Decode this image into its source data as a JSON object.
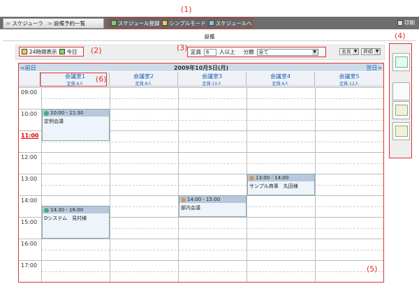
{
  "annotations": {
    "a1": "(1)",
    "a2": "(2)",
    "a3": "(3)",
    "a4": "(4)",
    "a5": "(5)",
    "a6": "(6)"
  },
  "nav": {
    "schedule": "スケジューラ",
    "reservations": "設備予約一覧"
  },
  "toolbar": {
    "register": "スケジュール登録",
    "simple": "シンプルモード",
    "goto": "スケジュールへ",
    "print": "印刷"
  },
  "section_title": "設備",
  "options": {
    "all_day": "24時間表示",
    "today": "今日",
    "capacity_label": "定員",
    "capacity_value": "6",
    "capacity_suffix": "人以上",
    "category_label": "分類",
    "category_value": "全て",
    "sort1": "名前",
    "sort2": "昇順"
  },
  "calendar": {
    "prev": "<前日",
    "next": "翌日>",
    "date": "2009年10月5日(月)",
    "rooms": [
      {
        "name": "会議室1",
        "cap": "定員:6人"
      },
      {
        "name": "会議室2",
        "cap": "定員:8人"
      },
      {
        "name": "会議室3",
        "cap": "定員:10人"
      },
      {
        "name": "会議室4",
        "cap": "定員:6人"
      },
      {
        "name": "会議室5",
        "cap": "定員:12人"
      }
    ],
    "hours": [
      "09:00",
      "10:00",
      "11:00",
      "12:00",
      "13:00",
      "14:00",
      "15:00",
      "16:00",
      "17:00"
    ],
    "current_hour": "11:00",
    "events": [
      {
        "time": "10:00 - 11:30",
        "title": "定例会議"
      },
      {
        "time": "14:30 - 16:00",
        "title": "Dシステム　見村様"
      },
      {
        "time": "14:00 - 15:00",
        "title": "部内会議"
      },
      {
        "time": "13:00 - 14:00",
        "title": "サンプル商事　丸田様"
      }
    ]
  }
}
